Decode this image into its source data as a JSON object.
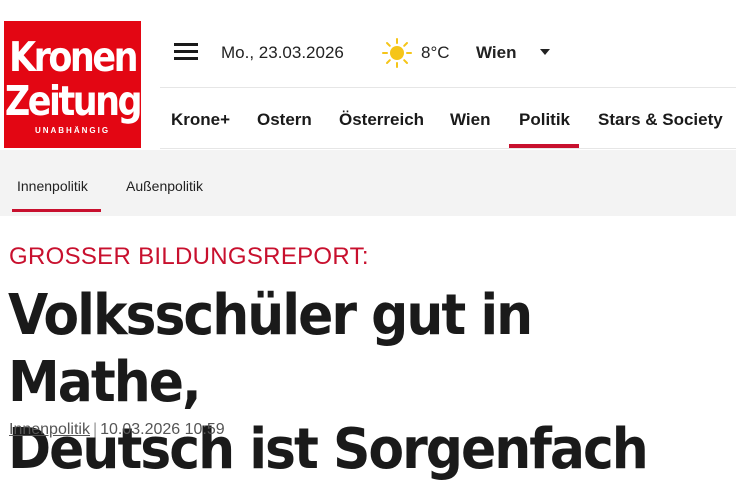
{
  "logo": {
    "line1": "Kronen",
    "line2": "Zeitung",
    "tagline": "UNABHÄNGIG",
    "color": "#e30613"
  },
  "topbar": {
    "date": "Mo., 23.03.2026",
    "weather_icon": "sun-icon",
    "temperature": "8°C",
    "city": "Wien"
  },
  "main_nav": {
    "items": [
      "Krone+",
      "Ostern",
      "Österreich",
      "Wien",
      "Politik",
      "Stars & Society"
    ],
    "active": "Politik"
  },
  "sub_nav": {
    "items": [
      "Innenpolitik",
      "Außenpolitik"
    ],
    "active": "Innenpolitik"
  },
  "article": {
    "kicker": "GROSSER BILDUNGSREPORT:",
    "title_line1": "Volksschüler gut in Mathe,",
    "title_line2": "Deutsch ist Sorgenfach",
    "category": "Innenpolitik",
    "separator": "|",
    "timestamp": "10.03.2026 10:59"
  },
  "colors": {
    "accent": "#c8102e",
    "subnav_bg": "#f3f3f3"
  }
}
